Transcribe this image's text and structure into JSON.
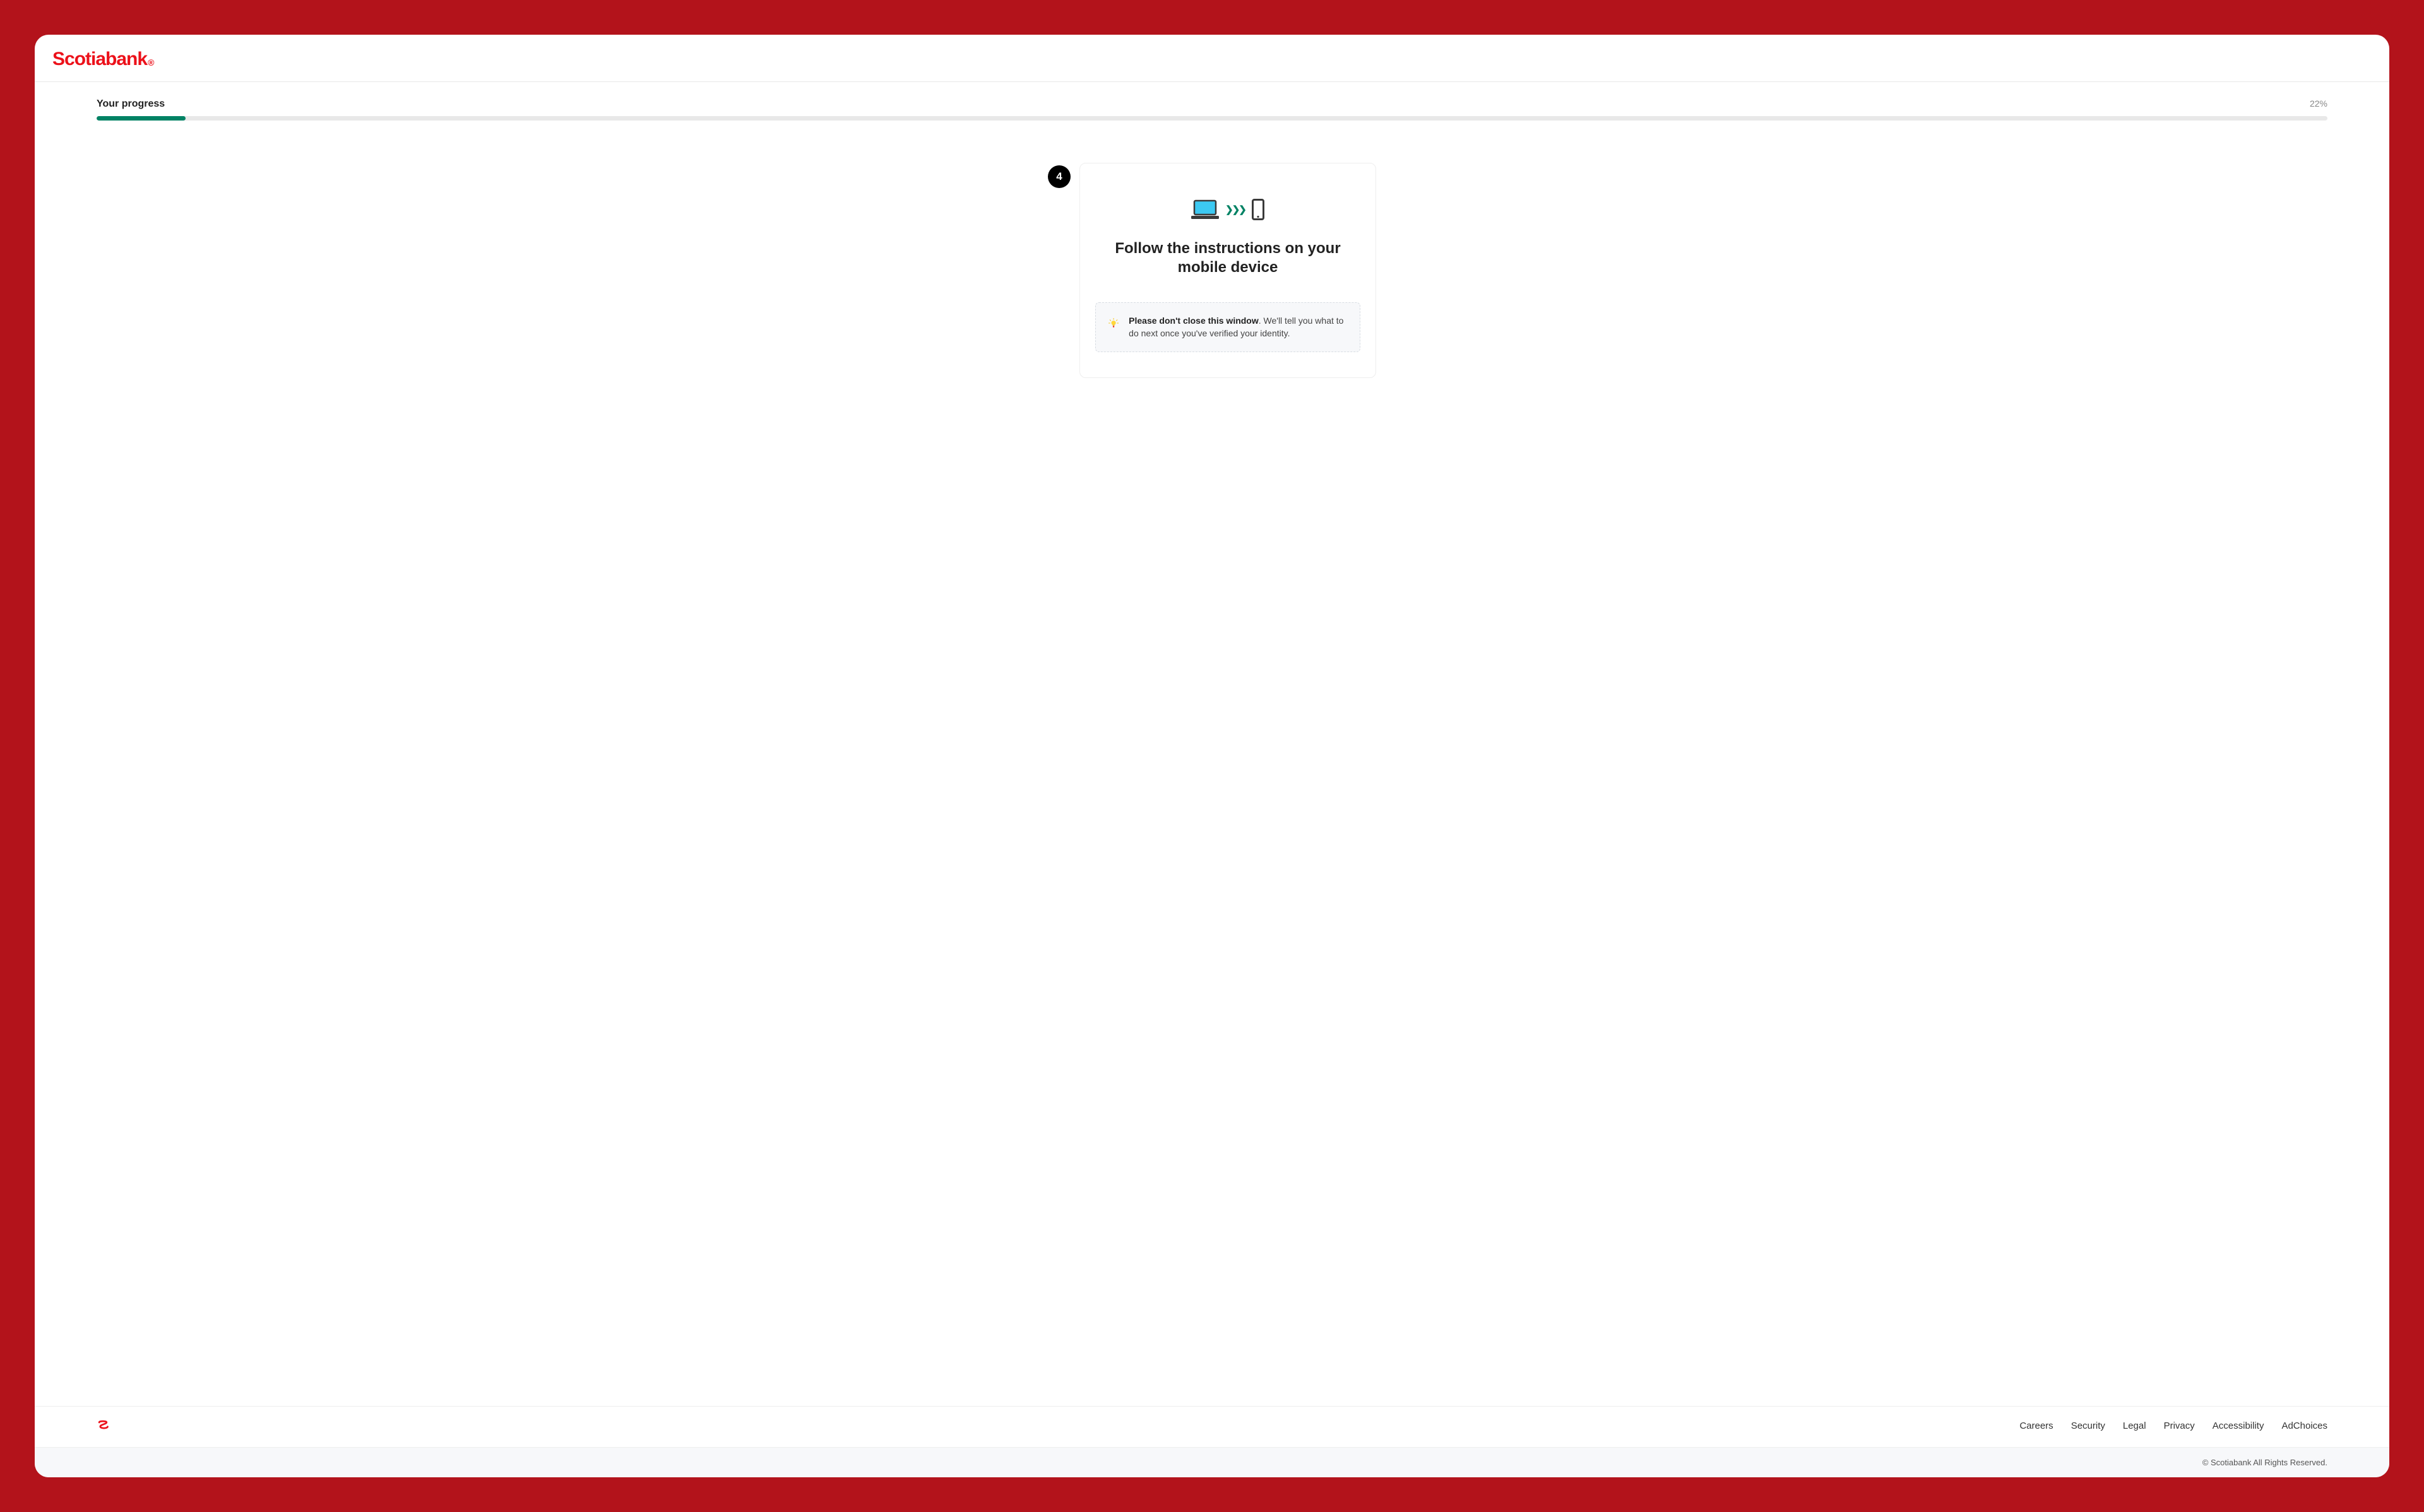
{
  "brand": {
    "name": "Scotiabank"
  },
  "progress": {
    "label": "Your progress",
    "pct_text": "22%",
    "pct": 22
  },
  "step": {
    "number": "4"
  },
  "card": {
    "title": "Follow the instructions on your mobile device",
    "tip_bold": "Please don't close this window",
    "tip_rest": ". We'll tell you what to do next once you've verified your identity."
  },
  "footer": {
    "links": [
      "Careers",
      "Security",
      "Legal",
      "Privacy",
      "Accessibility",
      "AdChoices"
    ],
    "copyright": "© Scotiabank All Rights Reserved."
  }
}
